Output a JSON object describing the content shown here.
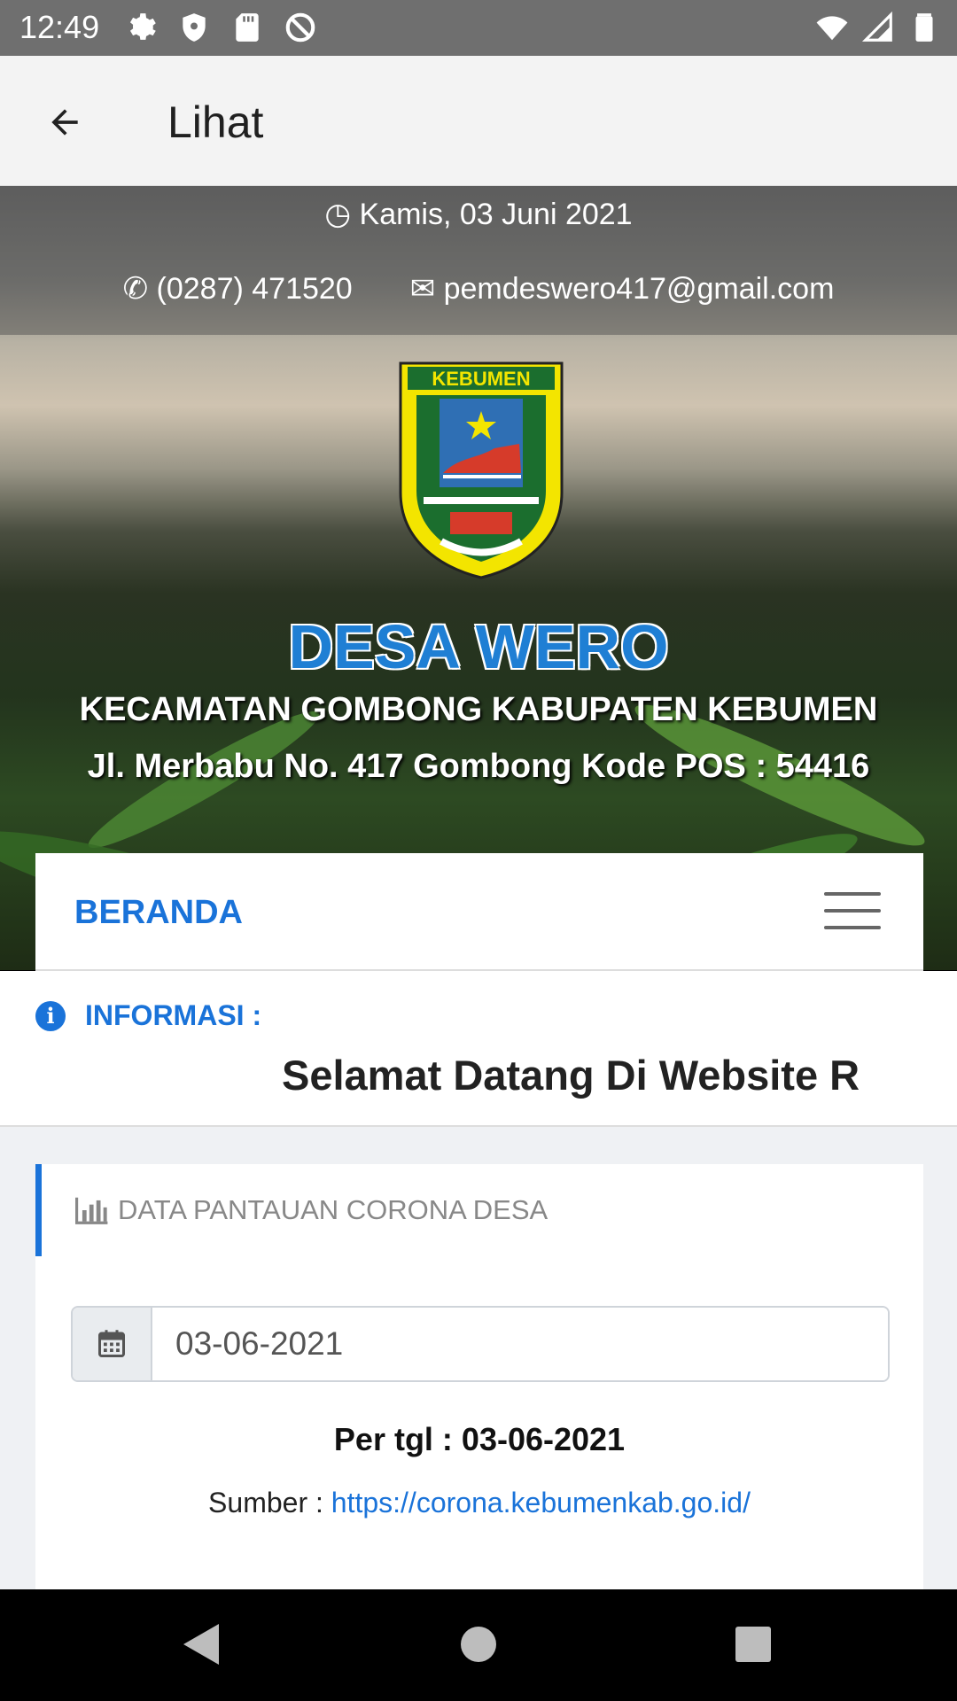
{
  "status_bar": {
    "time": "12:49",
    "left_icons": [
      "gear-icon",
      "shield-icon",
      "sd-card-icon",
      "at-icon"
    ],
    "right_icons": [
      "wifi-icon",
      "signal-icon",
      "battery-icon"
    ]
  },
  "app_bar": {
    "back_icon": "arrow-left-icon",
    "title": "Lihat"
  },
  "hero": {
    "date": "Kamis, 03 Juni 2021",
    "phone": "(0287) 471520",
    "email": "pemdeswero417@gmail.com",
    "logo_text": "KEBUMEN",
    "village_name": "DESA WERO",
    "subtitle": "KECAMATAN GOMBONG KABUPATEN KEBUMEN",
    "address": "Jl. Merbabu No. 417 Gombong Kode POS : 54416"
  },
  "nav": {
    "home_label": "BERANDA",
    "menu_icon": "hamburger-icon"
  },
  "info": {
    "label": "INFORMASI :",
    "marquee": "Selamat Datang Di Website R"
  },
  "card": {
    "title": "DATA PANTAUAN CORONA DESA",
    "date_value": "03-06-2021",
    "per_tgl": "Per tgl : 03-06-2021",
    "source_label": "Sumber : ",
    "source_link": "https://corona.kebumenkab.go.id/"
  },
  "system_nav": [
    "back-triangle-icon",
    "home-circle-icon",
    "recents-square-icon"
  ],
  "colors": {
    "accent": "#1a73d9",
    "status_bar": "#6f6f6f",
    "app_bar": "#f3f3f3"
  }
}
